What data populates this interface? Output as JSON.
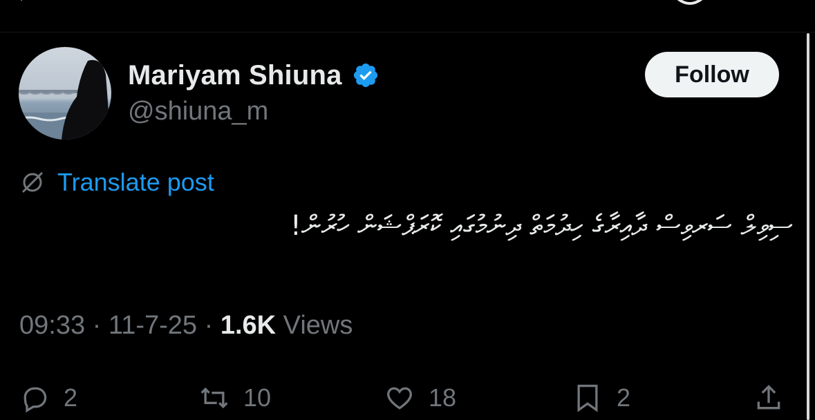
{
  "author": {
    "name": "Mariyam Shiuna",
    "handle": "@shiuna_m",
    "verified": true
  },
  "follow_label": "Follow",
  "translate_label": "Translate post",
  "post_text": "ސިވިލް ސަރވިސް ދާއިރާގެ ހިދުމަތް ދިނުމުގައި ކޮރަޕްޝަން ހުރުން!",
  "meta": {
    "time": "09:33",
    "separator": "·",
    "date": "11-7-25",
    "views_count": "1.6K",
    "views_label": "Views"
  },
  "actions": {
    "replies": "2",
    "reposts": "10",
    "likes": "18",
    "bookmarks": "2"
  },
  "colors": {
    "background": "#000000",
    "primary_text": "#e7e9ea",
    "secondary_text": "#71767b",
    "link": "#1d9bf0",
    "verified": "#1d9bf0"
  },
  "icons": [
    "verified-badge-icon",
    "translate-icon",
    "reply-icon",
    "repost-icon",
    "like-icon",
    "bookmark-icon",
    "share-icon"
  ]
}
